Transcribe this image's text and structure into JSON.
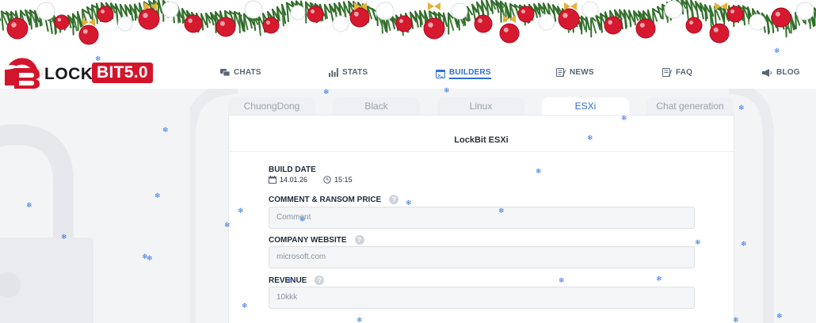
{
  "brand": {
    "lock_text": "LOCK",
    "bit_text": "BIT5.0",
    "brand_color": "#d3152c"
  },
  "nav": [
    {
      "label": "CHATS",
      "icon": "chat-icon",
      "active": false
    },
    {
      "label": "STATS",
      "icon": "stats-icon",
      "active": false
    },
    {
      "label": "BUILDERS",
      "icon": "builders-icon",
      "active": true
    },
    {
      "label": "NEWS",
      "icon": "news-icon",
      "active": false
    },
    {
      "label": "FAQ",
      "icon": "faq-icon",
      "active": false
    },
    {
      "label": "BLOG",
      "icon": "megaphone-icon",
      "active": false
    }
  ],
  "tabs": [
    {
      "label": "ChuongDong",
      "active": false
    },
    {
      "label": "Black",
      "active": false
    },
    {
      "label": "Linux",
      "active": false
    },
    {
      "label": "ESXi",
      "active": true
    },
    {
      "label": "Chat generation",
      "active": false
    }
  ],
  "card": {
    "title": "LockBit ESXi",
    "build_date": {
      "label": "BUILD DATE",
      "date": "14.01.26",
      "time": "15:15"
    },
    "comment": {
      "label": "COMMENT & RANSOM PRICE",
      "placeholder": "Comment"
    },
    "website": {
      "label": "COMPANY WEBSITE",
      "placeholder": "microsoft.com"
    },
    "revenue": {
      "label": "REVENUE",
      "placeholder": "10kkk"
    }
  },
  "colors": {
    "accent": "#2f6fd6",
    "ornament_red": "#d7192f",
    "ornament_gold": "#e3b23c",
    "pine_green": "#2f6b2a"
  }
}
